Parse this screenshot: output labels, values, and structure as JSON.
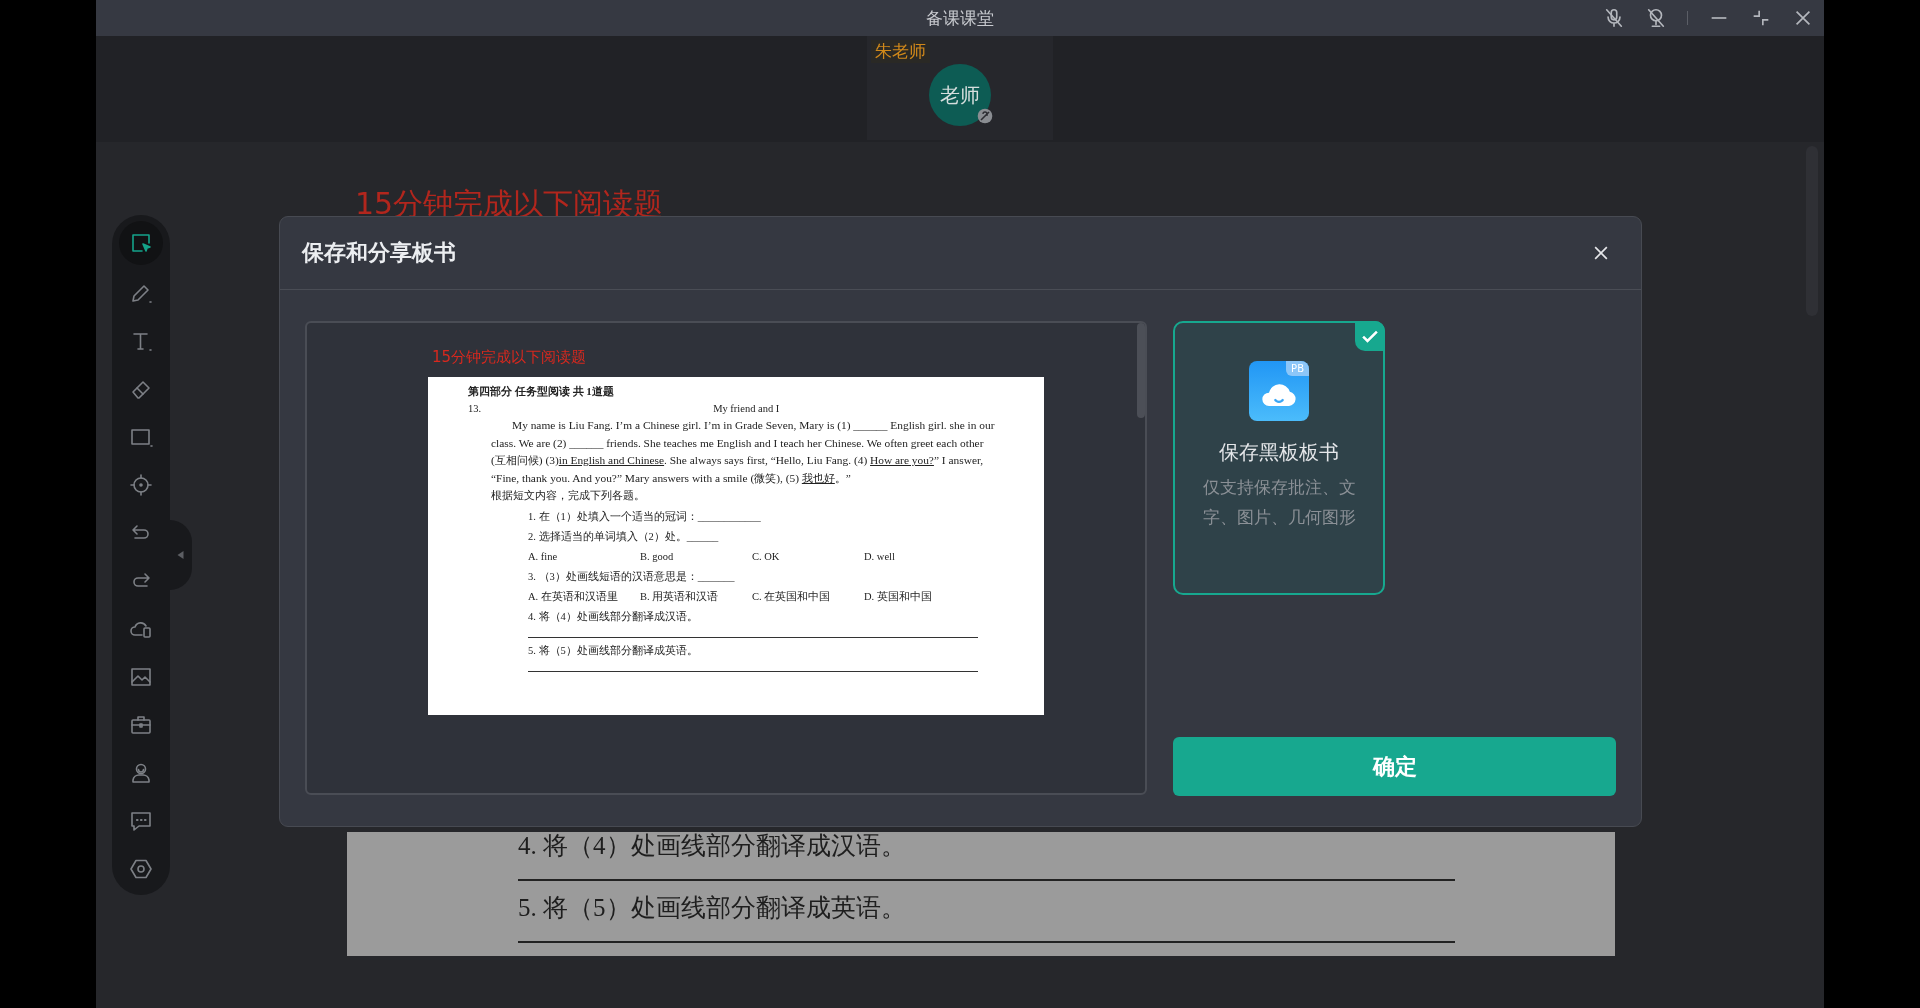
{
  "window": {
    "title": "备课课堂",
    "controls": [
      {
        "kind": "mic-off"
      },
      {
        "kind": "camera-off"
      },
      {
        "kind": "minimize"
      },
      {
        "kind": "restore"
      },
      {
        "kind": "close"
      }
    ]
  },
  "teacher": {
    "name": "朱老师",
    "avatar_label": "老师"
  },
  "toolbar": {
    "items": [
      {
        "kind": "select",
        "selected": true
      },
      {
        "kind": "pen",
        "selected": false
      },
      {
        "kind": "text",
        "selected": false
      },
      {
        "kind": "eraser",
        "selected": false
      },
      {
        "kind": "rectangle",
        "selected": false
      },
      {
        "kind": "pointer",
        "selected": false
      },
      {
        "kind": "undo",
        "selected": false
      },
      {
        "kind": "redo",
        "selected": false
      },
      {
        "kind": "cloud",
        "selected": false
      },
      {
        "kind": "image",
        "selected": false
      },
      {
        "kind": "toolbox",
        "selected": false
      },
      {
        "kind": "person",
        "selected": false
      },
      {
        "kind": "chat",
        "selected": false
      },
      {
        "kind": "settings",
        "selected": false
      }
    ]
  },
  "board": {
    "title": "15分钟完成以下阅读题",
    "lines": [
      "4.  将（4）处画线部分翻译成汉语。",
      "5.  将（5）处画线部分翻译成英语。"
    ]
  },
  "dialog": {
    "title": "保存和分享板书",
    "preview": {
      "title": "15分钟完成以下阅读题",
      "page": {
        "heading": "第四部分  任务型阅读  共  1道题",
        "number": "13.",
        "subtitle": "My friend and I",
        "paragraph": [
          {
            "text": "My name is Liu Fang. I’m a Chinese girl. I’m in Grade Seven, Mary is (1) ______ English girl. she in our class. We are (2) ______ friends. She teaches me English and I teach her Chinese. We often greet each other (互相问候) (3)",
            "underlined": false
          },
          {
            "text": "in English and Chinese",
            "underlined": true
          },
          {
            "text": ". She always says first, “Hello, Liu Fang. (4) ",
            "underlined": false
          },
          {
            "text": "How are you?",
            "underlined": true
          },
          {
            "text": "” I answer, “Fine, thank you. And you?” Mary answers with a smile (微笑), (5) ",
            "underlined": false
          },
          {
            "text": "我也好",
            "underlined": true
          },
          {
            "text": "。”",
            "underlined": false
          }
        ],
        "instruction": "根据短文内容，完成下列各题。",
        "items": [
          {
            "kind": "question",
            "text": "1.  在（1）处填入一个适当的冠词：____________"
          },
          {
            "kind": "question",
            "text": "2.  选择适当的单词填入（2）处。______"
          },
          {
            "kind": "options",
            "options": [
              "A.    fine",
              "B.    good",
              "C.    OK",
              "D.    well"
            ]
          },
          {
            "kind": "question",
            "text": "3.  （3）处画线短语的汉语意思是：_______"
          },
          {
            "kind": "options",
            "options": [
              "A.   在英语和汉语里",
              "B.   用英语和汉语",
              "C.   在英国和中国",
              "D.   英国和中国"
            ]
          },
          {
            "kind": "question",
            "text": "4.  将（4）处画线部分翻译成汉语。"
          },
          {
            "kind": "answer-line"
          },
          {
            "kind": "question",
            "text": "5.  将（5）处画线部分翻译成英语。"
          },
          {
            "kind": "answer-line"
          }
        ]
      }
    },
    "options": [
      {
        "title": "保存黑板板书",
        "description": "仅支持保存批注、文字、图片、几何图形",
        "icon_badge": "PB",
        "selected": true
      }
    ],
    "confirm_button": "确定"
  }
}
